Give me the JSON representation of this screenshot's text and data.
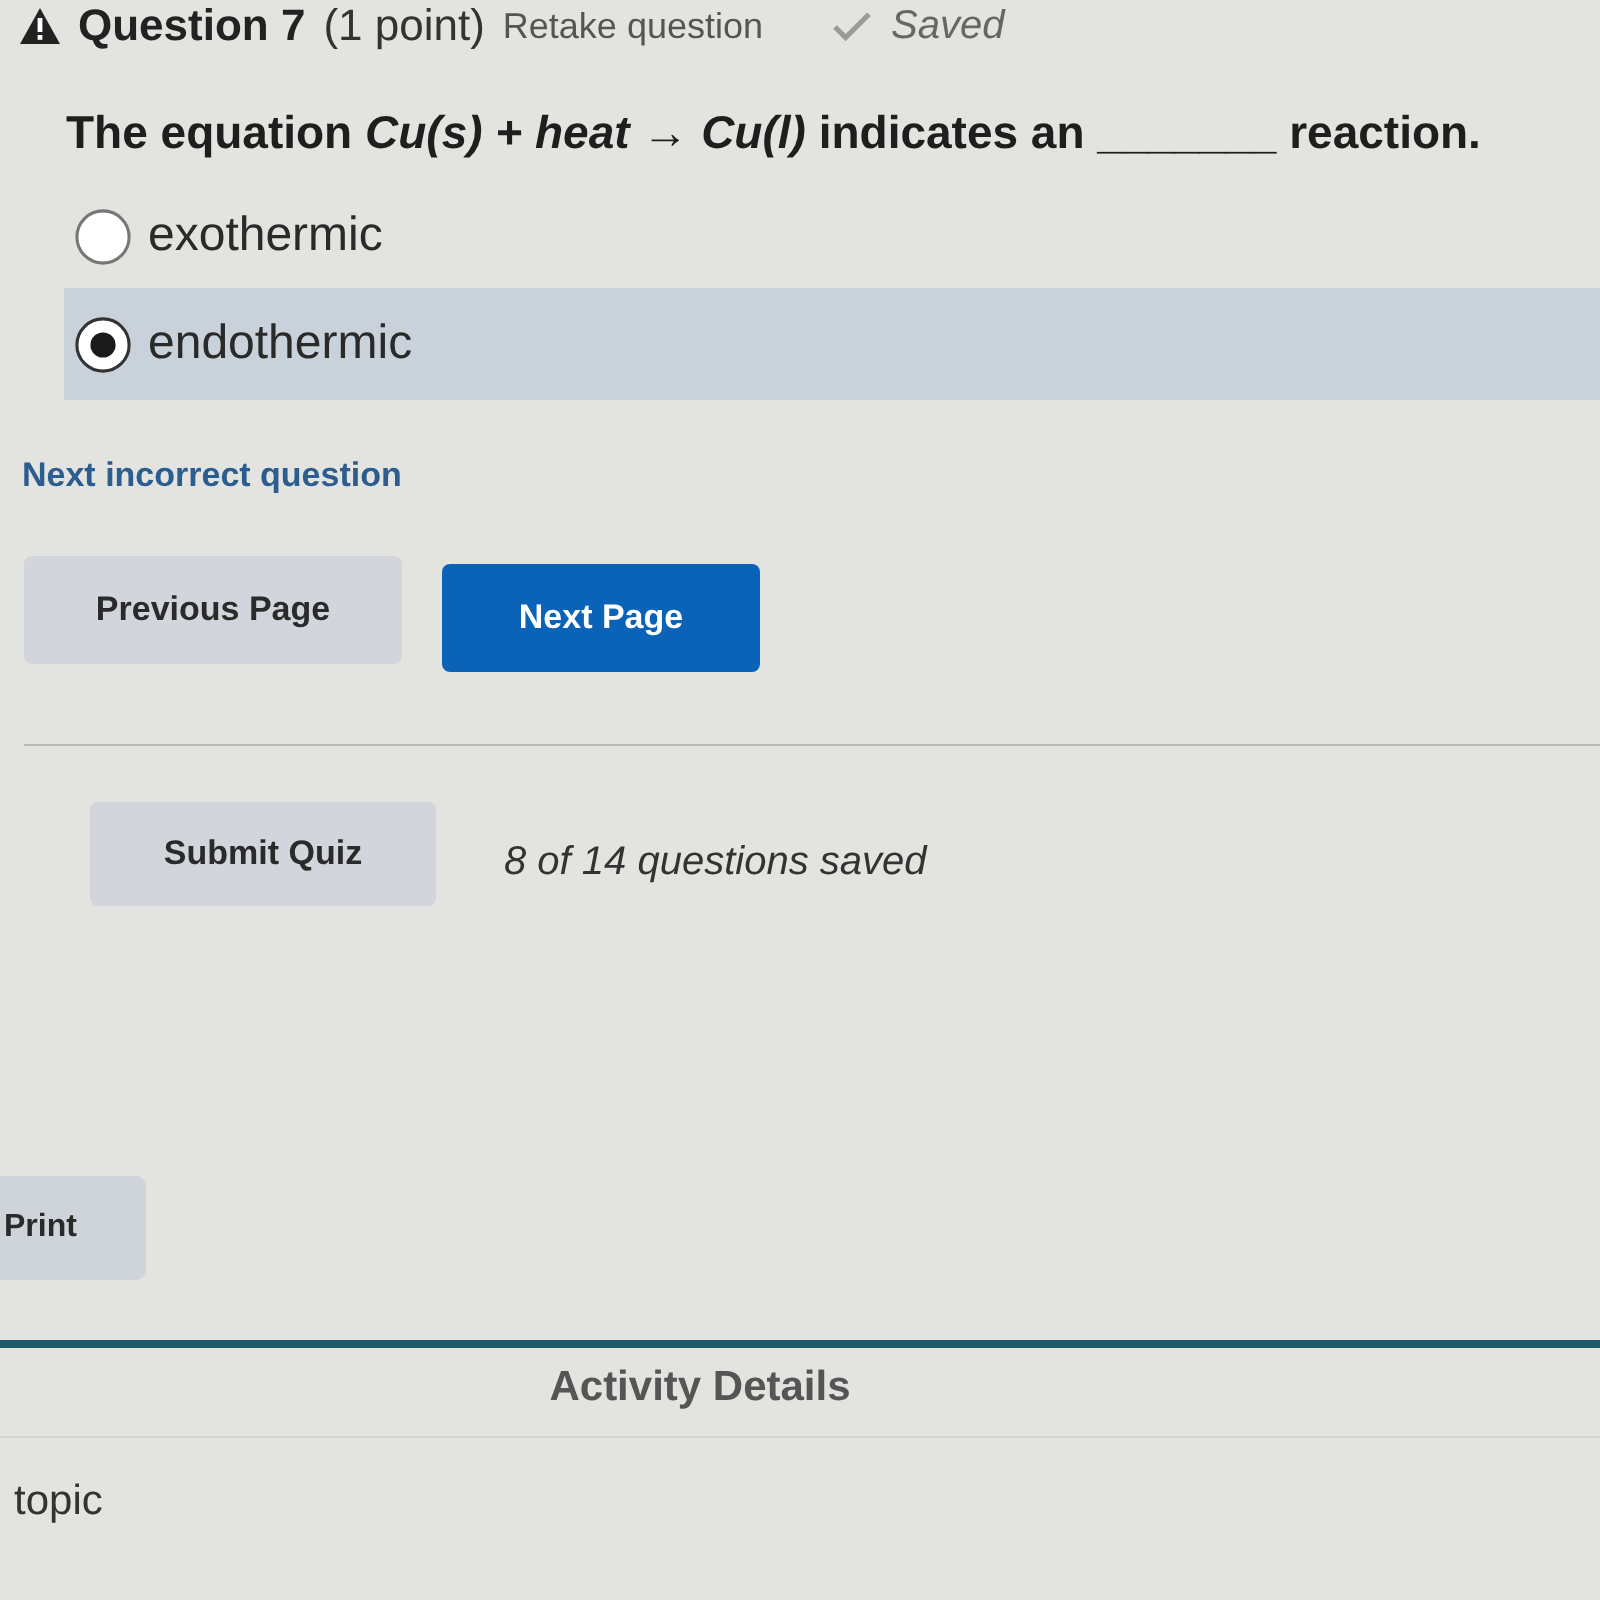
{
  "question_header": {
    "title": "Question 7",
    "points": "(1 point)",
    "retake_link": "Retake question",
    "status": "Saved"
  },
  "question": {
    "text": "The equation *Cu(s) + heat* → *Cu(l)* indicates an _______ reaction.",
    "options": [
      {
        "label": "exothermic",
        "selected": false
      },
      {
        "label": "endothermic",
        "selected": true
      }
    ]
  },
  "next_incorrect_link": "Next incorrect question",
  "pagination": [
    {
      "label": "Previous Page",
      "kind": "secondary"
    },
    {
      "label": "Next Page",
      "kind": "primary"
    }
  ],
  "submit": {
    "button": "Submit Quiz",
    "progress": "8 of 14 questions saved"
  },
  "print_button": "Print",
  "activity_details": {
    "title": "Activity Details",
    "row_1": "topic"
  }
}
